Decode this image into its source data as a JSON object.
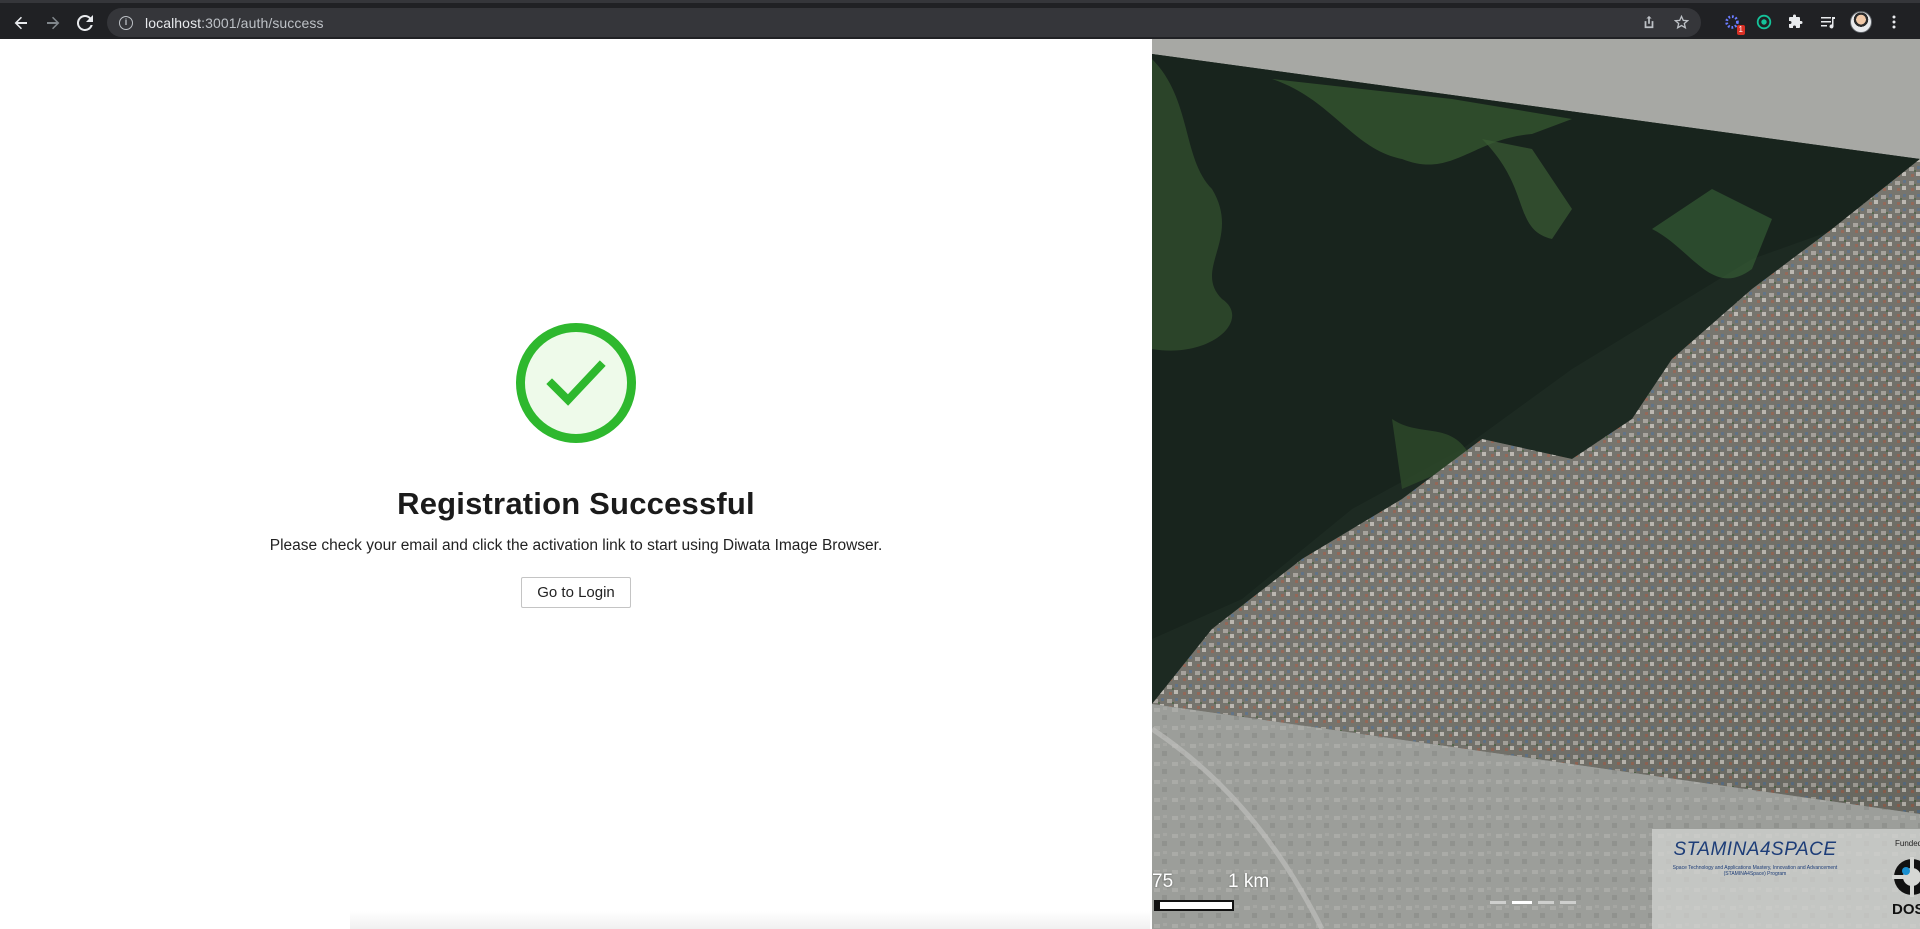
{
  "browser": {
    "url_host": "localhost",
    "url_path": ":3001/auth/success",
    "extension_badge": "1",
    "icons": [
      "back-arrow-icon",
      "forward-arrow-icon",
      "reload-icon",
      "info-icon",
      "share-icon",
      "bookmark-star-icon",
      "extension-icon",
      "puzzle-icon",
      "reading-list-icon",
      "menu-kebab-icon"
    ]
  },
  "page": {
    "title": "Registration Successful",
    "message": "Please check your email and click the activation link to start using Diwata Image Browser.",
    "login_button": "Go to Login",
    "success_color": "#2eb82e"
  },
  "map_panel": {
    "scale_left": "75",
    "scale_right": "1 km",
    "stamina_logo": "STAMINA4SPACE",
    "stamina_sub": "Space Technology and Applications Mastery, Innovation and Advancement (STAMINA4Space) Program",
    "funded_label": "Funded",
    "dost_label": "DOS"
  }
}
